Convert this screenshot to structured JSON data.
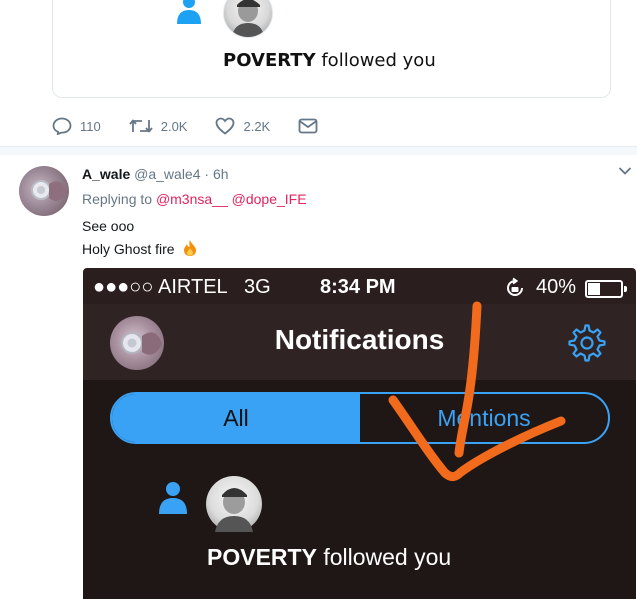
{
  "quoted_tweet": {
    "notification": {
      "user": "POVERTY",
      "action_text": "followed you"
    }
  },
  "actions": {
    "reply": {
      "icon": "reply-icon",
      "count": "110"
    },
    "retweet": {
      "icon": "retweet-icon",
      "count": "2.0K"
    },
    "like": {
      "icon": "heart-icon",
      "count": "2.2K"
    },
    "message": {
      "icon": "envelope-icon"
    }
  },
  "reply_tweet": {
    "name": "A_wale",
    "handle_time": "@a_wale4 · 6h",
    "replying_prefix": "Replying to",
    "mentions": "@m3nsa__ @dope_IFE",
    "line1": "See ooo",
    "line2": "Holy Ghost fire",
    "emoji": "fire-icon"
  },
  "phone": {
    "status_bar": {
      "signal": "●●●○○",
      "carrier": "AIRTEL",
      "network": "3G",
      "time": "8:34 PM",
      "battery": "40%"
    },
    "title": "Notifications",
    "tabs": {
      "all": "All",
      "mentions": "Mentions"
    },
    "notification": {
      "user": "POVERTY",
      "action_text": "followed you"
    }
  },
  "colors": {
    "accent": "#3aa2f5",
    "mention": "#e0245e",
    "scribble": "#f26a1b",
    "phone_bg": "#2a1f1e"
  }
}
